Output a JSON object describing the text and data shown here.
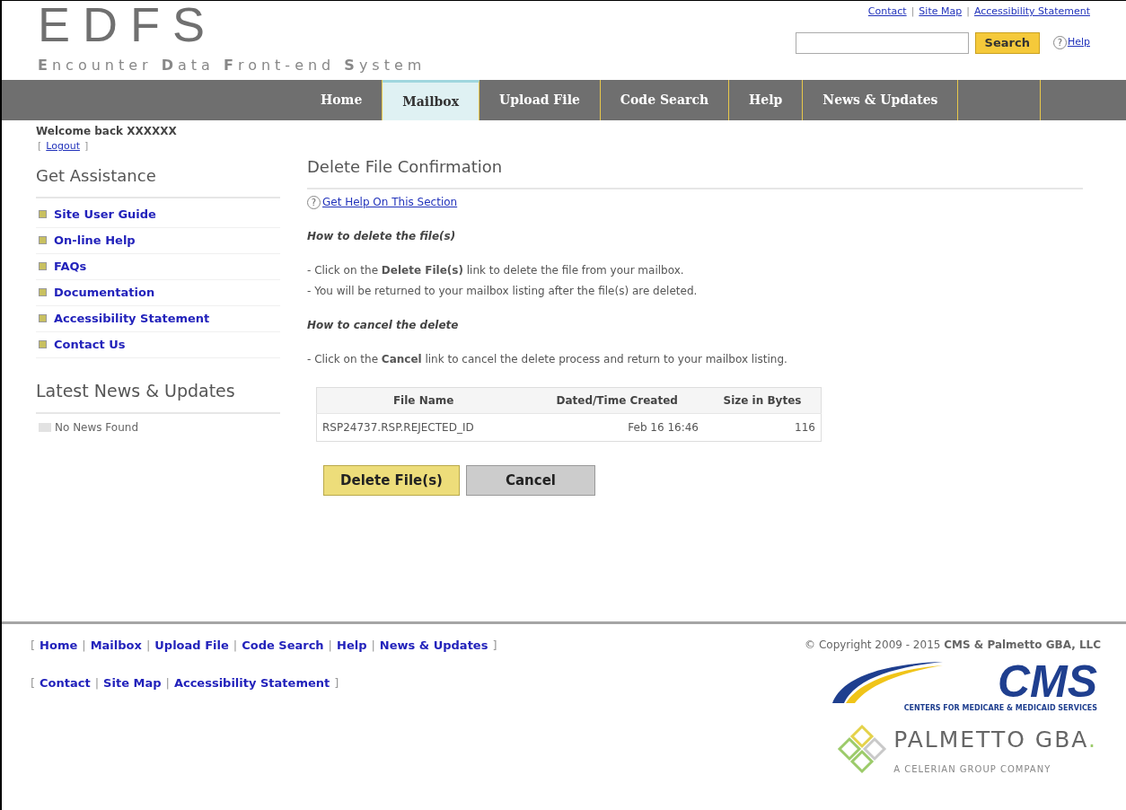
{
  "header": {
    "logo": "EDFS",
    "subtitle": "**E**ncounter **D**ata **F**ront-end **S**ystem",
    "top_links": [
      {
        "kind": "link",
        "text": "Contact"
      },
      {
        "kind": "sep",
        "text": "|"
      },
      {
        "kind": "link",
        "text": "Site Map"
      },
      {
        "kind": "sep",
        "text": "|"
      },
      {
        "kind": "link",
        "text": "Accessibility Statement"
      }
    ],
    "search": {
      "button": "Search"
    },
    "help_icon": "?",
    "help": "Help"
  },
  "tabs": [
    {
      "label": "Home",
      "selected": false
    },
    {
      "label": "Mailbox",
      "selected": true
    },
    {
      "label": "Upload File",
      "selected": false
    },
    {
      "label": "Code Search",
      "selected": false
    },
    {
      "label": "Help",
      "selected": false
    },
    {
      "label": "News & Updates",
      "selected": false
    }
  ],
  "sidebar": {
    "welcome": "Welcome back **XXXXXX**",
    "logout": [
      {
        "kind": "sep",
        "text": "["
      },
      {
        "kind": "link",
        "text": "Logout"
      },
      {
        "kind": "sep",
        "text": "]"
      }
    ],
    "assistance_title": "Get Assistance",
    "assistance_links": [
      "Site User Guide",
      "On-line Help",
      "FAQs",
      "Documentation",
      "Accessibility Statement",
      "Contact Us"
    ],
    "news_title": "Latest News & Updates",
    "news_items": [
      "No News Found"
    ]
  },
  "content": {
    "title": "Delete File Confirmation",
    "help_icon": "?",
    "help_link": "Get Help On This Section",
    "sections": [
      {
        "heading": "How to delete the file(s)",
        "lines": [
          "- Click on the **Delete File(s)** link to delete the file from your mailbox.",
          "- You will be returned to your mailbox listing after the file(s) are deleted."
        ]
      },
      {
        "heading": "How to cancel the delete",
        "lines": [
          "- Click on the **Cancel** link to cancel the delete process and return to your mailbox listing."
        ]
      }
    ],
    "table": {
      "columns": [
        "File Name",
        "Dated/Time Created",
        "Size in Bytes"
      ],
      "rows": [
        [
          "RSP24737.RSP.REJECTED_ID",
          "Feb 16 16:46",
          "116"
        ]
      ]
    },
    "buttons": [
      {
        "label": "Delete File(s)",
        "kind": "primary"
      },
      {
        "label": "Cancel",
        "kind": "secondary"
      }
    ]
  },
  "footer": {
    "nav": [
      {
        "kind": "sep",
        "text": "["
      },
      {
        "kind": "link",
        "text": "Home"
      },
      {
        "kind": "sep",
        "text": "|"
      },
      {
        "kind": "link",
        "text": "Mailbox"
      },
      {
        "kind": "sep",
        "text": "|"
      },
      {
        "kind": "link",
        "text": "Upload File"
      },
      {
        "kind": "sep",
        "text": "|"
      },
      {
        "kind": "link",
        "text": "Code Search"
      },
      {
        "kind": "sep",
        "text": "|"
      },
      {
        "kind": "link",
        "text": "Help"
      },
      {
        "kind": "sep",
        "text": "|"
      },
      {
        "kind": "link",
        "text": "News & Updates"
      },
      {
        "kind": "sep",
        "text": "]"
      }
    ],
    "nav2": [
      {
        "kind": "sep",
        "text": "["
      },
      {
        "kind": "link",
        "text": "Contact"
      },
      {
        "kind": "sep",
        "text": "|"
      },
      {
        "kind": "link",
        "text": "Site Map"
      },
      {
        "kind": "sep",
        "text": "|"
      },
      {
        "kind": "link",
        "text": "Accessibility Statement"
      },
      {
        "kind": "sep",
        "text": "]"
      }
    ],
    "copyright": "© Copyright 2009 - 2015 **CMS & Palmetto GBA, LLC**",
    "cms_logo": {
      "name": "CMS",
      "tagline": "CENTERS FOR MEDICARE & MEDICAID SERVICES"
    },
    "palmetto_logo": {
      "name": "PALMETTO GBA",
      "mark": ".",
      "tagline": "A CELERIAN GROUP COMPANY"
    }
  }
}
